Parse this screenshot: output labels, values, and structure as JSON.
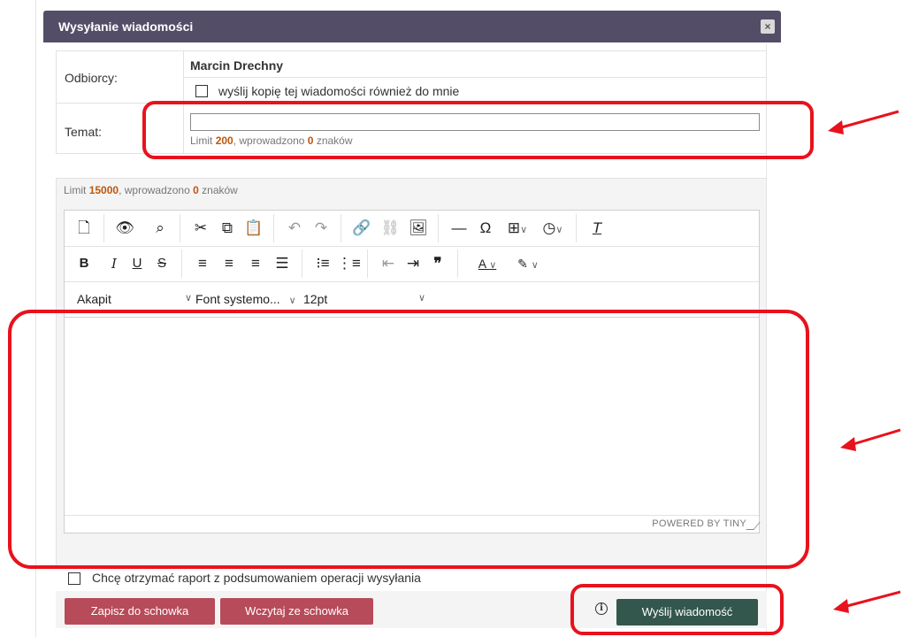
{
  "dialog": {
    "title": "Wysyłanie wiadomości",
    "close_label": "×"
  },
  "form": {
    "recipients_label": "Odbiorcy:",
    "recipient_name": "Marcin Drechny",
    "copy_to_me_label": "wyślij kopię tej wiadomości również do mnie",
    "subject_label": "Temat:",
    "subject_value": "",
    "subject_limit": {
      "prefix": "Limit",
      "limit": "200",
      "middle": ", wprowadzono",
      "count": "0",
      "suffix": "znaków"
    }
  },
  "editor": {
    "limit": {
      "prefix": "Limit",
      "limit": "15000",
      "middle": ", wprowadzono",
      "count": "0",
      "suffix": "znaków"
    },
    "toolbar_row1": [
      "new-document",
      "preview",
      "search",
      "cut",
      "copy",
      "paste",
      "undo",
      "redo",
      "link",
      "unlink",
      "image",
      "horizontal-line",
      "special-char",
      "table",
      "date-time",
      "clear-format"
    ],
    "toolbar_row2": [
      "bold",
      "italic",
      "underline",
      "strikethrough",
      "align-left",
      "align-center",
      "align-right",
      "justify",
      "bullet-list",
      "numbered-list",
      "outdent",
      "indent",
      "blockquote",
      "text-color",
      "highlight-color"
    ],
    "block_format": "Akapit",
    "font_family": "Font systemo...",
    "font_size": "12pt",
    "content": "",
    "powered_by": "POWERED BY TINY"
  },
  "report_checkbox_label": "Chcę otrzymać raport z podsumowaniem operacji wysyłania",
  "buttons": {
    "save_clipboard": "Zapisz do schowka",
    "load_clipboard": "Wczytaj ze schowka",
    "send": "Wyślij wiadomość"
  },
  "colors": {
    "header": "#544d67",
    "limit_highlight": "#c0550b",
    "button_red": "#b74b5a",
    "button_green": "#33574c",
    "annotation": "#e8121c"
  }
}
